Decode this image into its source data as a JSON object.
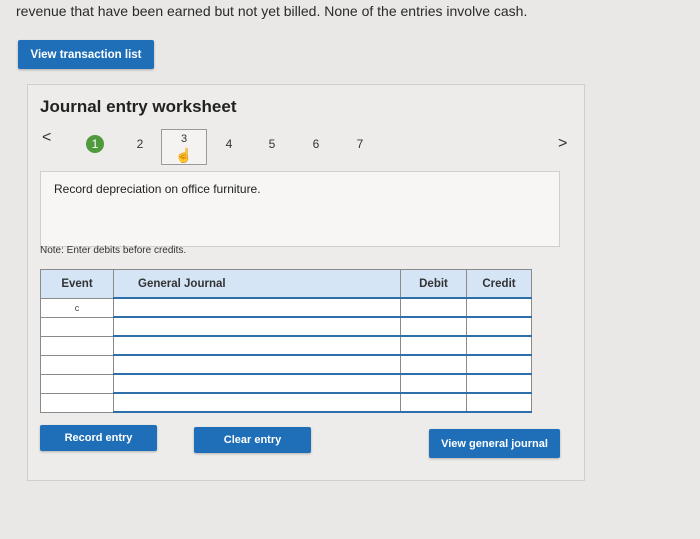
{
  "intro_text": "revenue that have been earned but not yet billed. None of the entries involve cash.",
  "view_transaction_list_label": "View transaction list",
  "worksheet": {
    "title": "Journal entry worksheet",
    "nav_prev": "<",
    "nav_next": ">",
    "steps": [
      "1",
      "2",
      "3",
      "4",
      "5",
      "6",
      "7"
    ],
    "description": "Record depreciation on office furniture.",
    "note": "Note: Enter debits before credits."
  },
  "table": {
    "headers": {
      "event": "Event",
      "general_journal": "General Journal",
      "debit": "Debit",
      "credit": "Credit"
    },
    "rows": [
      {
        "event": "c",
        "account": "",
        "debit": "",
        "credit": ""
      },
      {
        "event": "",
        "account": "",
        "debit": "",
        "credit": ""
      },
      {
        "event": "",
        "account": "",
        "debit": "",
        "credit": ""
      },
      {
        "event": "",
        "account": "",
        "debit": "",
        "credit": ""
      },
      {
        "event": "",
        "account": "",
        "debit": "",
        "credit": ""
      },
      {
        "event": "",
        "account": "",
        "debit": "",
        "credit": ""
      }
    ]
  },
  "buttons": {
    "record_entry": "Record entry",
    "clear_entry": "Clear entry",
    "view_general_journal": "View general journal"
  },
  "colors": {
    "button_blue": "#1f6fb8",
    "step_active_green": "#4f9a3d",
    "header_blue": "#d5e5f5"
  }
}
